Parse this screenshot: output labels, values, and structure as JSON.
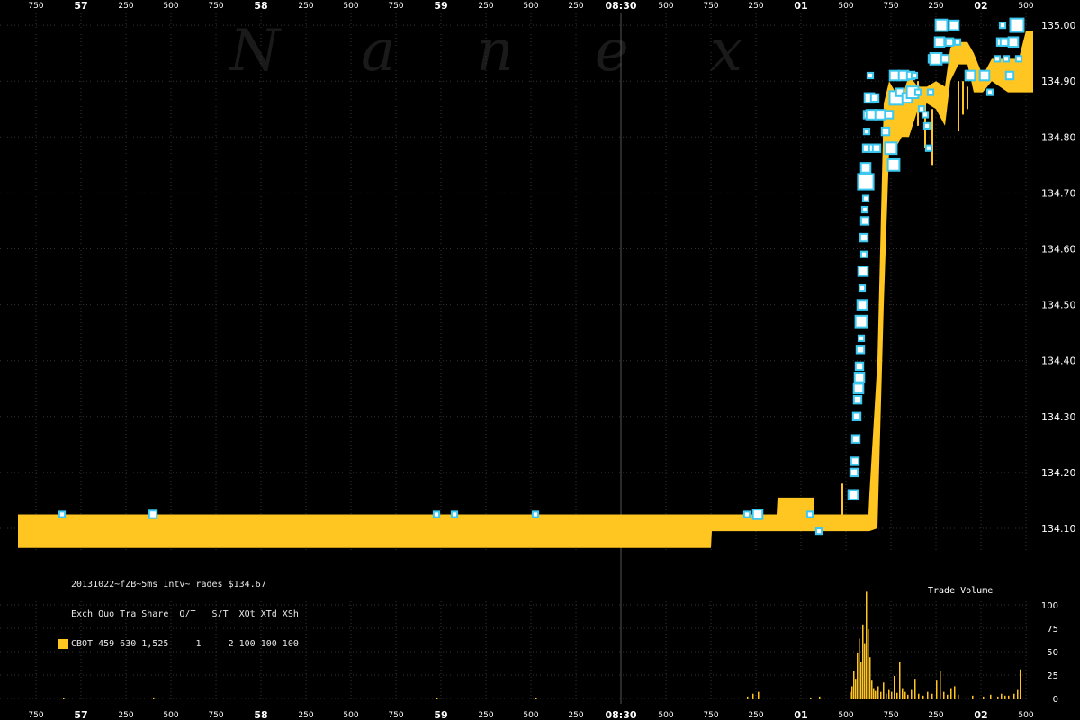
{
  "watermark": "N a n e x",
  "legend": {
    "title": "20131022~fZB~5ms Intv~Trades $134.67",
    "header": "Exch Quo Tra Share  Q/T   S/T  XQt XTd XSh",
    "row": "CBOT 459 630 1,525     1     2 100 100 100"
  },
  "colors": {
    "background": "#000000",
    "band": "#ffc520",
    "trade_marker": "#3cc8f0",
    "grid": "#333333"
  },
  "chart_data": [
    {
      "type": "line",
      "title": "",
      "x_axis": {
        "minor_ticks": [
          "750",
          "250",
          "500",
          "750",
          "250",
          "500",
          "750",
          "250",
          "500",
          "250",
          "500",
          "750",
          "250",
          "500",
          "750",
          "250",
          "500",
          "750"
        ],
        "major_ticks": [
          "57",
          "58",
          "59",
          "08:30",
          "01",
          "02"
        ]
      },
      "y_axis": {
        "ticks": [
          "135.00",
          "134.90",
          "134.80",
          "134.70",
          "134.60",
          "134.50",
          "134.40",
          "134.30",
          "134.20",
          "134.10"
        ],
        "ylim": [
          134.05,
          135.02
        ]
      },
      "series": [
        {
          "kind": "bid_ask_band",
          "x": [
            0,
            770,
            770,
            843,
            843,
            884,
            884,
            945,
            945,
            962,
            962,
            990,
            990,
            1010,
            1010,
            1035,
            1035,
            1060,
            1060,
            1080,
            1080,
            1120,
            1120,
            1130
          ],
          "points": [
            {
              "x": 0,
              "low": 134.065,
              "high": 134.125
            },
            {
              "x": 770,
              "low": 134.065,
              "high": 134.125
            },
            {
              "x": 771,
              "low": 134.095,
              "high": 134.125
            },
            {
              "x": 843,
              "low": 134.095,
              "high": 134.125
            },
            {
              "x": 844,
              "low": 134.095,
              "high": 134.155
            },
            {
              "x": 884,
              "low": 134.095,
              "high": 134.155
            },
            {
              "x": 885,
              "low": 134.095,
              "high": 134.125
            },
            {
              "x": 945,
              "low": 134.095,
              "high": 134.125
            },
            {
              "x": 946,
              "low": 134.095,
              "high": 134.16
            },
            {
              "x": 955,
              "low": 134.1,
              "high": 134.4
            },
            {
              "x": 962,
              "low": 134.5,
              "high": 134.86
            },
            {
              "x": 968,
              "low": 134.78,
              "high": 134.9
            },
            {
              "x": 975,
              "low": 134.78,
              "high": 134.88
            },
            {
              "x": 982,
              "low": 134.8,
              "high": 134.87
            },
            {
              "x": 990,
              "low": 134.8,
              "high": 134.91
            },
            {
              "x": 1000,
              "low": 134.85,
              "high": 134.89
            },
            {
              "x": 1010,
              "low": 134.86,
              "high": 134.89
            },
            {
              "x": 1020,
              "low": 134.85,
              "high": 134.9
            },
            {
              "x": 1030,
              "low": 134.82,
              "high": 134.89
            },
            {
              "x": 1036,
              "low": 134.9,
              "high": 134.96
            },
            {
              "x": 1045,
              "low": 134.93,
              "high": 134.97
            },
            {
              "x": 1055,
              "low": 134.93,
              "high": 134.97
            },
            {
              "x": 1062,
              "low": 134.88,
              "high": 134.95
            },
            {
              "x": 1072,
              "low": 134.88,
              "high": 134.91
            },
            {
              "x": 1082,
              "low": 134.9,
              "high": 134.94
            },
            {
              "x": 1100,
              "low": 134.88,
              "high": 134.94
            },
            {
              "x": 1112,
              "low": 134.88,
              "high": 134.94
            },
            {
              "x": 1120,
              "low": 134.88,
              "high": 134.99
            },
            {
              "x": 1128,
              "low": 134.88,
              "high": 134.99
            }
          ]
        },
        {
          "kind": "trades",
          "points": [
            {
              "x": 69,
              "y": 134.125,
              "s": 1
            },
            {
              "x": 170,
              "y": 134.125,
              "s": 2
            },
            {
              "x": 485,
              "y": 134.125,
              "s": 1
            },
            {
              "x": 505,
              "y": 134.125,
              "s": 1
            },
            {
              "x": 595,
              "y": 134.125,
              "s": 1
            },
            {
              "x": 830,
              "y": 134.125,
              "s": 1
            },
            {
              "x": 842,
              "y": 134.125,
              "s": 3
            },
            {
              "x": 900,
              "y": 134.125,
              "s": 1
            },
            {
              "x": 910,
              "y": 134.095,
              "s": 1
            },
            {
              "x": 948,
              "y": 134.16,
              "s": 3
            },
            {
              "x": 949,
              "y": 134.2,
              "s": 2
            },
            {
              "x": 950,
              "y": 134.22,
              "s": 2
            },
            {
              "x": 951,
              "y": 134.26,
              "s": 2
            },
            {
              "x": 952,
              "y": 134.3,
              "s": 2
            },
            {
              "x": 953,
              "y": 134.33,
              "s": 2
            },
            {
              "x": 954,
              "y": 134.35,
              "s": 3
            },
            {
              "x": 955,
              "y": 134.37,
              "s": 3
            },
            {
              "x": 955,
              "y": 134.39,
              "s": 2
            },
            {
              "x": 956,
              "y": 134.42,
              "s": 2
            },
            {
              "x": 957,
              "y": 134.44,
              "s": 1
            },
            {
              "x": 957,
              "y": 134.47,
              "s": 4
            },
            {
              "x": 958,
              "y": 134.5,
              "s": 3
            },
            {
              "x": 958,
              "y": 134.53,
              "s": 1
            },
            {
              "x": 959,
              "y": 134.56,
              "s": 3
            },
            {
              "x": 960,
              "y": 134.59,
              "s": 1
            },
            {
              "x": 960,
              "y": 134.62,
              "s": 2
            },
            {
              "x": 961,
              "y": 134.65,
              "s": 2
            },
            {
              "x": 961,
              "y": 134.67,
              "s": 1
            },
            {
              "x": 962,
              "y": 134.69,
              "s": 1
            },
            {
              "x": 962,
              "y": 134.72,
              "s": 6
            },
            {
              "x": 962,
              "y": 134.745,
              "s": 3
            },
            {
              "x": 963,
              "y": 134.78,
              "s": 2
            },
            {
              "x": 963,
              "y": 134.81,
              "s": 1
            },
            {
              "x": 964,
              "y": 134.84,
              "s": 2
            },
            {
              "x": 966,
              "y": 134.87,
              "s": 3
            },
            {
              "x": 967,
              "y": 134.91,
              "s": 1
            },
            {
              "x": 968,
              "y": 134.84,
              "s": 3
            },
            {
              "x": 970,
              "y": 134.78,
              "s": 2
            },
            {
              "x": 972,
              "y": 134.87,
              "s": 2
            },
            {
              "x": 974,
              "y": 134.78,
              "s": 2
            },
            {
              "x": 978,
              "y": 134.84,
              "s": 3
            },
            {
              "x": 984,
              "y": 134.81,
              "s": 2
            },
            {
              "x": 988,
              "y": 134.84,
              "s": 2
            },
            {
              "x": 990,
              "y": 134.78,
              "s": 4
            },
            {
              "x": 993,
              "y": 134.75,
              "s": 4
            },
            {
              "x": 994,
              "y": 134.91,
              "s": 3
            },
            {
              "x": 996,
              "y": 134.87,
              "s": 5
            },
            {
              "x": 1000,
              "y": 134.88,
              "s": 2
            },
            {
              "x": 1004,
              "y": 134.91,
              "s": 3
            },
            {
              "x": 1008,
              "y": 134.87,
              "s": 3
            },
            {
              "x": 1012,
              "y": 134.91,
              "s": 2
            },
            {
              "x": 1014,
              "y": 134.88,
              "s": 4
            },
            {
              "x": 1016,
              "y": 134.91,
              "s": 1
            },
            {
              "x": 1020,
              "y": 134.88,
              "s": 1
            },
            {
              "x": 1024,
              "y": 134.85,
              "s": 1
            },
            {
              "x": 1028,
              "y": 134.84,
              "s": 1
            },
            {
              "x": 1030,
              "y": 134.82,
              "s": 1
            },
            {
              "x": 1032,
              "y": 134.78,
              "s": 1
            },
            {
              "x": 1034,
              "y": 134.88,
              "s": 1
            },
            {
              "x": 1036,
              "y": 134.94,
              "s": 2
            },
            {
              "x": 1040,
              "y": 134.94,
              "s": 4
            },
            {
              "x": 1044,
              "y": 134.97,
              "s": 3
            },
            {
              "x": 1046,
              "y": 135.0,
              "s": 4
            },
            {
              "x": 1050,
              "y": 134.94,
              "s": 2
            },
            {
              "x": 1055,
              "y": 134.97,
              "s": 2
            },
            {
              "x": 1060,
              "y": 135.0,
              "s": 3
            },
            {
              "x": 1064,
              "y": 134.97,
              "s": 1
            },
            {
              "x": 1078,
              "y": 134.91,
              "s": 3
            },
            {
              "x": 1094,
              "y": 134.91,
              "s": 3
            },
            {
              "x": 1100,
              "y": 134.88,
              "s": 1
            },
            {
              "x": 1108,
              "y": 134.94,
              "s": 1
            },
            {
              "x": 1112,
              "y": 134.97,
              "s": 2
            },
            {
              "x": 1114,
              "y": 135.0,
              "s": 1
            },
            {
              "x": 1116,
              "y": 134.97,
              "s": 2
            },
            {
              "x": 1118,
              "y": 134.94,
              "s": 1
            },
            {
              "x": 1122,
              "y": 134.91,
              "s": 2
            },
            {
              "x": 1126,
              "y": 134.97,
              "s": 3
            },
            {
              "x": 1130,
              "y": 135.0,
              "s": 5
            },
            {
              "x": 1132,
              "y": 134.94,
              "s": 1
            }
          ]
        }
      ]
    },
    {
      "type": "bar",
      "title": "Trade Volume",
      "y_axis": {
        "ticks": [
          "100",
          "75",
          "50",
          "25",
          "0"
        ],
        "ylim": [
          0,
          115
        ]
      },
      "values": [
        {
          "x": 70,
          "v": 1
        },
        {
          "x": 170,
          "v": 2
        },
        {
          "x": 485,
          "v": 1
        },
        {
          "x": 595,
          "v": 1
        },
        {
          "x": 830,
          "v": 3
        },
        {
          "x": 836,
          "v": 6
        },
        {
          "x": 842,
          "v": 8
        },
        {
          "x": 900,
          "v": 2
        },
        {
          "x": 910,
          "v": 3
        },
        {
          "x": 944,
          "v": 8
        },
        {
          "x": 946,
          "v": 14
        },
        {
          "x": 948,
          "v": 30
        },
        {
          "x": 950,
          "v": 22
        },
        {
          "x": 952,
          "v": 50
        },
        {
          "x": 954,
          "v": 65
        },
        {
          "x": 956,
          "v": 40
        },
        {
          "x": 958,
          "v": 80
        },
        {
          "x": 960,
          "v": 60
        },
        {
          "x": 962,
          "v": 115
        },
        {
          "x": 964,
          "v": 75
        },
        {
          "x": 966,
          "v": 45
        },
        {
          "x": 968,
          "v": 20
        },
        {
          "x": 970,
          "v": 12
        },
        {
          "x": 972,
          "v": 9
        },
        {
          "x": 975,
          "v": 14
        },
        {
          "x": 978,
          "v": 8
        },
        {
          "x": 981,
          "v": 18
        },
        {
          "x": 984,
          "v": 6
        },
        {
          "x": 987,
          "v": 10
        },
        {
          "x": 990,
          "v": 8
        },
        {
          "x": 993,
          "v": 25
        },
        {
          "x": 996,
          "v": 7
        },
        {
          "x": 999,
          "v": 40
        },
        {
          "x": 1002,
          "v": 12
        },
        {
          "x": 1005,
          "v": 8
        },
        {
          "x": 1008,
          "v": 5
        },
        {
          "x": 1012,
          "v": 10
        },
        {
          "x": 1016,
          "v": 22
        },
        {
          "x": 1020,
          "v": 6
        },
        {
          "x": 1025,
          "v": 4
        },
        {
          "x": 1030,
          "v": 8
        },
        {
          "x": 1035,
          "v": 6
        },
        {
          "x": 1040,
          "v": 20
        },
        {
          "x": 1044,
          "v": 30
        },
        {
          "x": 1048,
          "v": 8
        },
        {
          "x": 1052,
          "v": 5
        },
        {
          "x": 1056,
          "v": 12
        },
        {
          "x": 1060,
          "v": 14
        },
        {
          "x": 1064,
          "v": 5
        },
        {
          "x": 1080,
          "v": 4
        },
        {
          "x": 1092,
          "v": 3
        },
        {
          "x": 1100,
          "v": 5
        },
        {
          "x": 1108,
          "v": 3
        },
        {
          "x": 1112,
          "v": 6
        },
        {
          "x": 1116,
          "v": 4
        },
        {
          "x": 1120,
          "v": 4
        },
        {
          "x": 1126,
          "v": 6
        },
        {
          "x": 1130,
          "v": 10
        },
        {
          "x": 1133,
          "v": 32
        }
      ]
    }
  ]
}
